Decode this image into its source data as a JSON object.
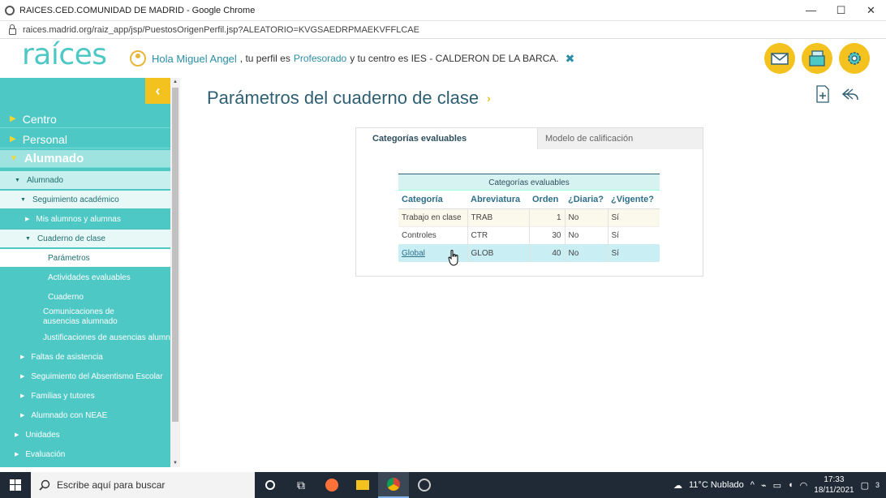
{
  "window": {
    "title": "RAICES.CED.COMUNIDAD DE MADRID - Google Chrome",
    "url": "raices.madrid.org/raiz_app/jsp/PuestosOrigenPerfil.jsp?ALEATORIO=KVGSAEDRPMAEKVFFLCAE",
    "minimize": "—",
    "maximize": "☐",
    "close": "✕"
  },
  "header": {
    "logo": "raíces",
    "greeting": "Hola Miguel Angel",
    "perfil_prefix": ", tu perfil es",
    "perfil": "Profesorado",
    "centro_text": "y tu centro es IES - CALDERON DE LA BARCA.",
    "icons": [
      "mail-icon",
      "documents-icon",
      "settings-icon"
    ]
  },
  "sidebar": {
    "collapse_label": "‹",
    "top_items": [
      {
        "label": "Centro"
      },
      {
        "label": "Personal"
      },
      {
        "label": "Alumnado"
      }
    ],
    "sub_items": [
      {
        "label": "Alumnado"
      },
      {
        "label": "Seguimiento académico"
      },
      {
        "label": "Mis alumnos y alumnas"
      },
      {
        "label": "Cuaderno de clase"
      },
      {
        "label": "Parámetros"
      },
      {
        "label": "Actividades evaluables"
      },
      {
        "label": "Cuaderno"
      },
      {
        "label": "Comunicaciones de ausencias alumnado"
      },
      {
        "label": "Justificaciones de ausencias alumnado"
      },
      {
        "label": "Faltas de asistencia"
      },
      {
        "label": "Seguimiento del Absentismo Escolar"
      },
      {
        "label": "Familias y tutores"
      },
      {
        "label": "Alumnado con NEAE"
      },
      {
        "label": "Unidades"
      },
      {
        "label": "Evaluación"
      }
    ]
  },
  "main": {
    "title": "Parámetros del cuaderno de clase",
    "tabs": [
      {
        "label": "Categorías evaluables"
      },
      {
        "label": "Modelo de calificación"
      }
    ],
    "table": {
      "caption": "Categorías evaluables",
      "headers": [
        "Categoría",
        "Abreviatura",
        "Orden",
        "¿Diaria?",
        "¿Vigente?"
      ],
      "rows": [
        {
          "categoria": "Trabajo en clase",
          "abreviatura": "TRAB",
          "orden": "1",
          "diaria": "No",
          "vigente": "Sí"
        },
        {
          "categoria": "Controles",
          "abreviatura": "CTR",
          "orden": "30",
          "diaria": "No",
          "vigente": "Sí"
        },
        {
          "categoria": "Global",
          "abreviatura": "GLOB",
          "orden": "40",
          "diaria": "No",
          "vigente": "Sí"
        }
      ]
    }
  },
  "taskbar": {
    "search_placeholder": "Escribe aquí para buscar",
    "weather": "11°C  Nublado",
    "time": "17:33",
    "date": "18/11/2021",
    "notifications": "3"
  }
}
